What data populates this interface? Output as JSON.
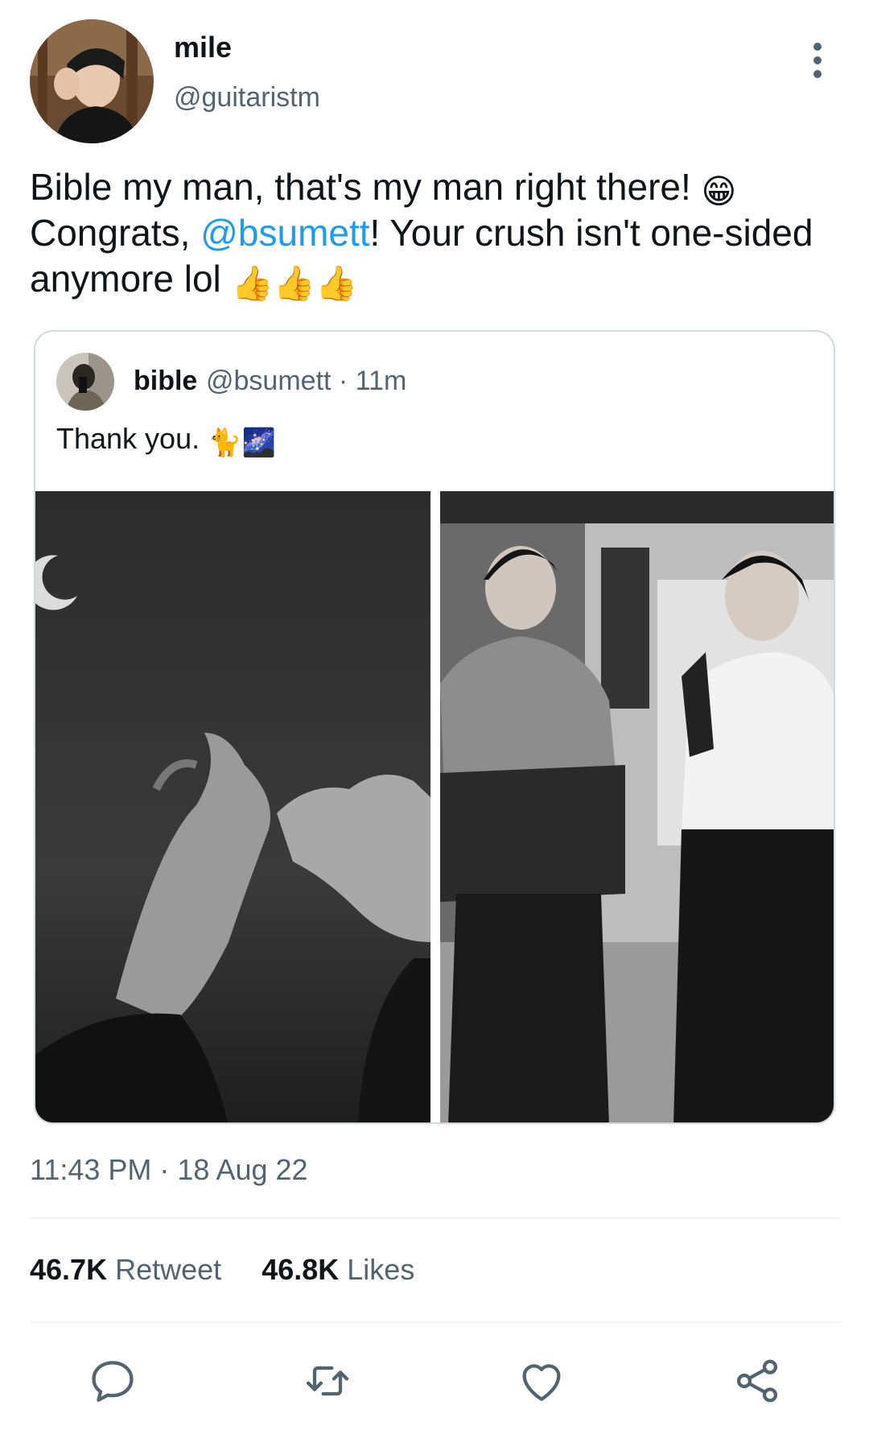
{
  "author": {
    "display_name": "mile",
    "handle": "@guitaristm"
  },
  "tweet": {
    "text_part1": "Bible my man, that's my man right there! ",
    "emoji_grin": "😁",
    "text_part2": "Congrats, ",
    "mention": "@bsumett",
    "text_part3": "! Your crush isn't one-sided anymore lol ",
    "emoji_thumbs": "👍👍👍"
  },
  "quote": {
    "display_name": "bible",
    "handle_time": "@bsumett · 11m",
    "text": "Thank you. ",
    "emojis": "🐈🌌"
  },
  "meta": {
    "timestamp": "11:43 PM · 18 Aug 22"
  },
  "stats": {
    "retweets_count": "46.7K",
    "retweets_label": "Retweet",
    "likes_count": "46.8K",
    "likes_label": "Likes"
  },
  "colors": {
    "accent": "#1d9bf0",
    "secondary_text": "#536471",
    "primary_text": "#0f1419",
    "divider": "#eff3f4"
  },
  "icons": {
    "reply": "reply-icon",
    "retweet": "retweet-icon",
    "like": "heart-icon",
    "share": "share-icon",
    "more": "more-vertical-icon"
  }
}
